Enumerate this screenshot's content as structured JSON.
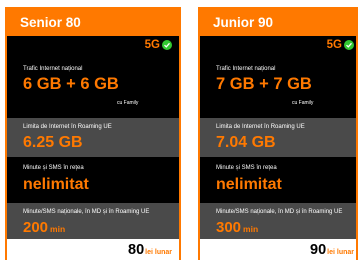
{
  "cards": [
    {
      "title": "Senior 80",
      "badge": "5G",
      "internet_label": "Trafic Internet național",
      "internet_value": "6 GB + 6 GB",
      "internet_note": "cu Family",
      "roaming_label": "Limita de Internet în Roaming UE",
      "roaming_value": "6.25 GB",
      "minutes_label": "Minute și SMS în rețea",
      "minutes_value": "nelimitat",
      "national_label": "Minute/SMS naționale, în MD și în Roaming UE",
      "national_value": "200",
      "national_unit": "min",
      "price": "80",
      "price_unit": "lei lunar"
    },
    {
      "title": "Junior 90",
      "badge": "5G",
      "internet_label": "Trafic Internet național",
      "internet_value": "7 GB + 7 GB",
      "internet_note": "cu Family",
      "roaming_label": "Limita de Internet în Roaming UE",
      "roaming_value": "7.04 GB",
      "minutes_label": "Minute și SMS în rețea",
      "minutes_value": "nelimitat",
      "national_label": "Minute/SMS naționale, în MD și în Roaming UE",
      "national_value": "300",
      "national_unit": "min",
      "price": "90",
      "price_unit": "lei lunar"
    }
  ],
  "colors": {
    "accent": "#ff7900",
    "card_bg": "#000000",
    "section_alt": "#4a4a4a",
    "check": "#32c832"
  },
  "icons": {
    "badge_icon": "check-circle-icon"
  }
}
